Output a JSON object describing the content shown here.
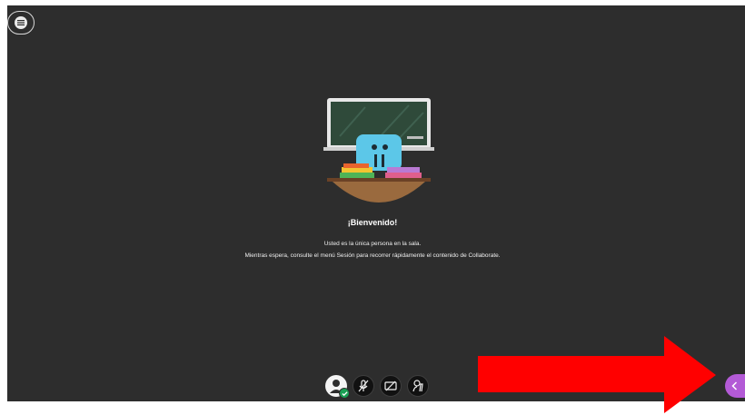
{
  "session": {
    "welcome_title": "¡Bienvenido!",
    "welcome_line1": "Usted es la única persona en la sala.",
    "welcome_line2": "Mientras espera, consulte el menú Sesión para recorrer rápidamente el contenido de Collaborate."
  },
  "icons": {
    "menu": "hamburger-menu-icon",
    "avatar": "user-avatar-icon",
    "status": "check-icon",
    "microphone": "microphone-muted-icon",
    "camera": "camera-off-icon",
    "hand": "raise-hand-icon",
    "panel": "chevron-left-icon"
  },
  "colors": {
    "stage": "#2d2d2d",
    "accent": "#b35ad6",
    "annotation": "#ff0000",
    "status": "#1a9f54"
  }
}
